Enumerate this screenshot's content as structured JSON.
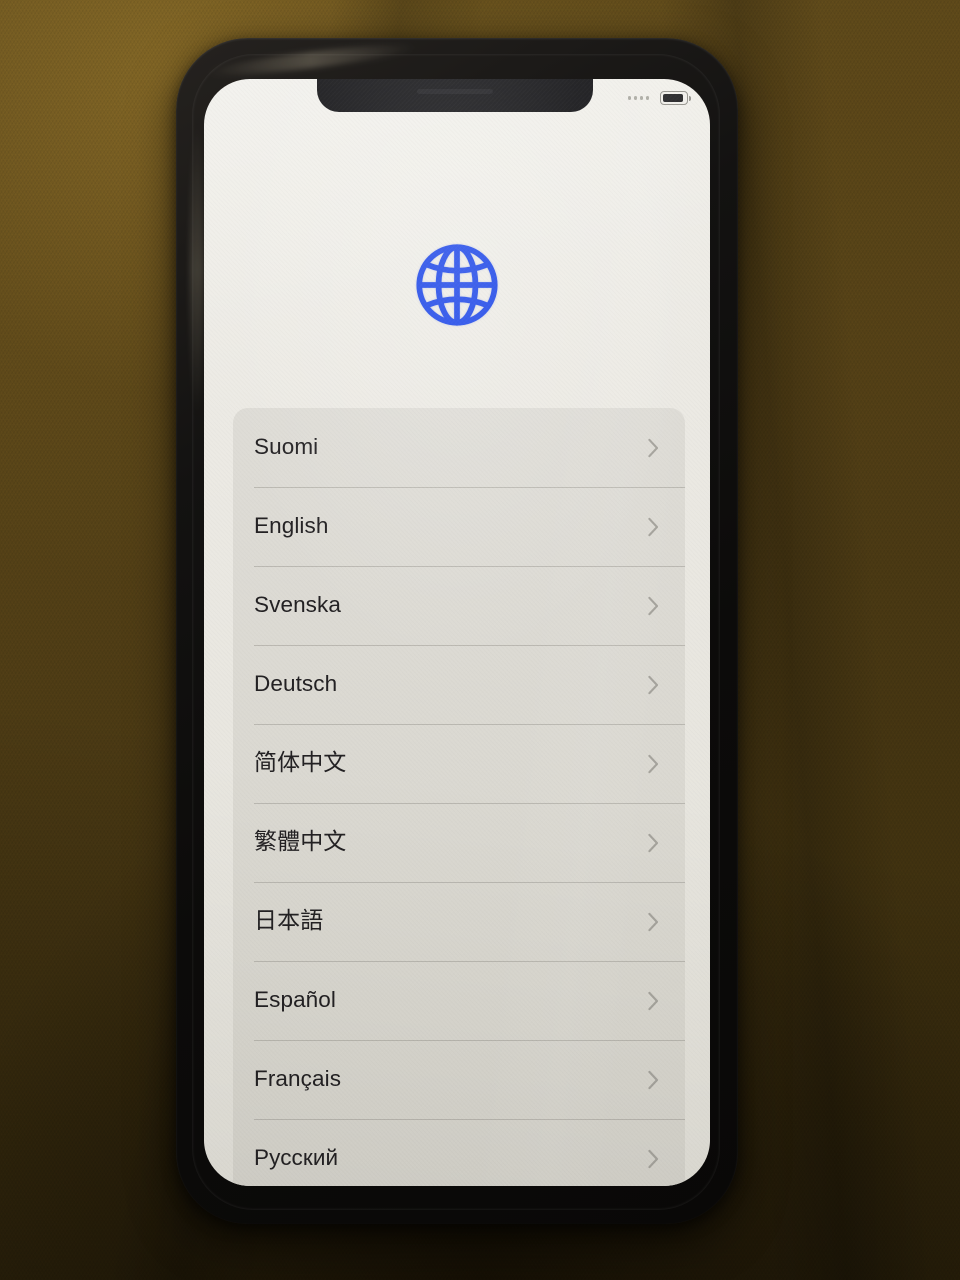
{
  "scene": {
    "description": "Photo of a smartphone in a black case lying on dark olive-brown fabric, showing the iOS language selection setup screen",
    "backdrop_color": "#4b3a14",
    "case_color": "#0c0b0a",
    "screen_color": "#eceae4"
  },
  "status_bar": {
    "signal_dots": 4,
    "battery_icon": "battery-icon",
    "signal_icon": "signal-dots-icon"
  },
  "header": {
    "icon": "globe-icon",
    "icon_color": "#1540e8"
  },
  "language_list": {
    "card_color": "#dbd9d2",
    "chevron_icon": "chevron-right-icon",
    "chevron_color": "#a3a19a",
    "items": [
      {
        "label": "Suomi",
        "script": "latin"
      },
      {
        "label": "English",
        "script": "latin"
      },
      {
        "label": "Svenska",
        "script": "latin"
      },
      {
        "label": "Deutsch",
        "script": "latin"
      },
      {
        "label": "简体中文",
        "script": "cjk"
      },
      {
        "label": "繁體中文",
        "script": "cjk"
      },
      {
        "label": "日本語",
        "script": "cjk"
      },
      {
        "label": "Español",
        "script": "latin"
      },
      {
        "label": "Français",
        "script": "latin"
      },
      {
        "label": "Русский",
        "script": "cyrillic"
      }
    ]
  }
}
